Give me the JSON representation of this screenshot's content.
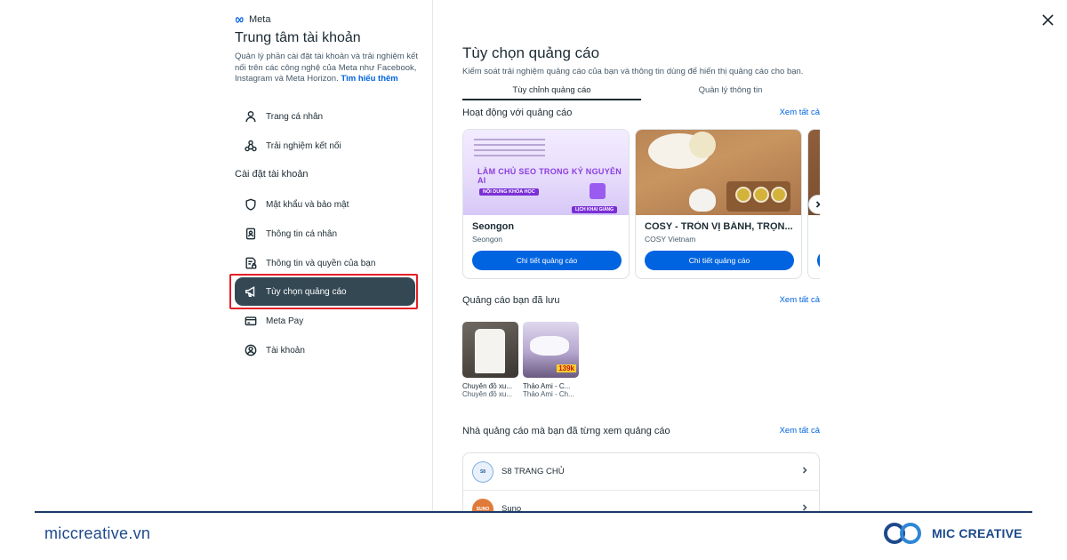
{
  "sidebar": {
    "logo_text": "Meta",
    "title": "Trung tâm tài khoản",
    "description": "Quản lý phần cài đặt tài khoản và trải nghiệm kết nối trên các công nghệ của Meta như Facebook, Instagram và Meta Horizon.",
    "learn_more": "Tìm hiểu thêm",
    "top_items": [
      {
        "label": "Trang cá nhân",
        "icon": "person-icon"
      },
      {
        "label": "Trải nghiệm kết nối",
        "icon": "connected-icon"
      }
    ],
    "settings_label": "Cài đặt tài khoản",
    "settings_items": [
      {
        "label": "Mật khẩu và bảo mật",
        "icon": "shield-icon"
      },
      {
        "label": "Thông tin cá nhân",
        "icon": "id-card-icon"
      },
      {
        "label": "Thông tin và quyền của bạn",
        "icon": "info-lock-icon"
      },
      {
        "label": "Tùy chọn quảng cáo",
        "icon": "megaphone-icon",
        "active": true
      },
      {
        "label": "Meta Pay",
        "icon": "card-icon"
      },
      {
        "label": "Tài khoản",
        "icon": "account-circle-icon"
      }
    ]
  },
  "main": {
    "title": "Tùy chọn quảng cáo",
    "subtitle": "Kiểm soát trải nghiệm quảng cáo của bạn và thông tin dùng để hiển thị quảng cáo cho bạn.",
    "tabs": [
      {
        "label": "Tùy chỉnh quảng cáo",
        "active": true
      },
      {
        "label": "Quản lý thông tin",
        "active": false
      }
    ],
    "activity": {
      "heading": "Hoạt động với quảng cáo",
      "see_all": "Xem tất cả",
      "cards": [
        {
          "name": "Seongon",
          "sub": "Seongon",
          "cta": "Chi tiết quảng cáo",
          "image_text": "LÀM CHỦ SEO TRONG KỶ NGUYÊN AI",
          "image_tag": "NỘI DUNG KHÓA HỌC",
          "image_tag2": "LỊCH KHAI GIẢNG"
        },
        {
          "name": "COSY - TRÒN VỊ BÁNH, TRỌN...",
          "sub": "COSY Vietnam",
          "cta": "Chi tiết quảng cáo"
        },
        {
          "name": "",
          "sub": "",
          "cta": ""
        }
      ]
    },
    "saved": {
      "heading": "Quảng cáo bạn đã lưu",
      "see_all": "Xem tất cả",
      "items": [
        {
          "title": "Chuyên đồ xu...",
          "sub": "Chuyên đồ xu..."
        },
        {
          "title": "Thảo Ami - C...",
          "sub": "Thảo Ami - Ch...",
          "badge": "139k"
        }
      ]
    },
    "advertisers": {
      "heading": "Nhà quảng cáo mà bạn đã từng xem quảng cáo",
      "see_all": "Xem tất cả",
      "items": [
        {
          "name": "S8 TRANG CHỦ",
          "avatar_text": "S8"
        },
        {
          "name": "Suno",
          "avatar_text": "SUNO"
        }
      ]
    }
  },
  "footer": {
    "site": "miccreative.vn",
    "brand": "MIC CREATIVE"
  },
  "colors": {
    "accent": "#0064e0",
    "active_nav": "#344854",
    "highlight": "#e41e26",
    "footer_brand": "#1e4a8c"
  }
}
